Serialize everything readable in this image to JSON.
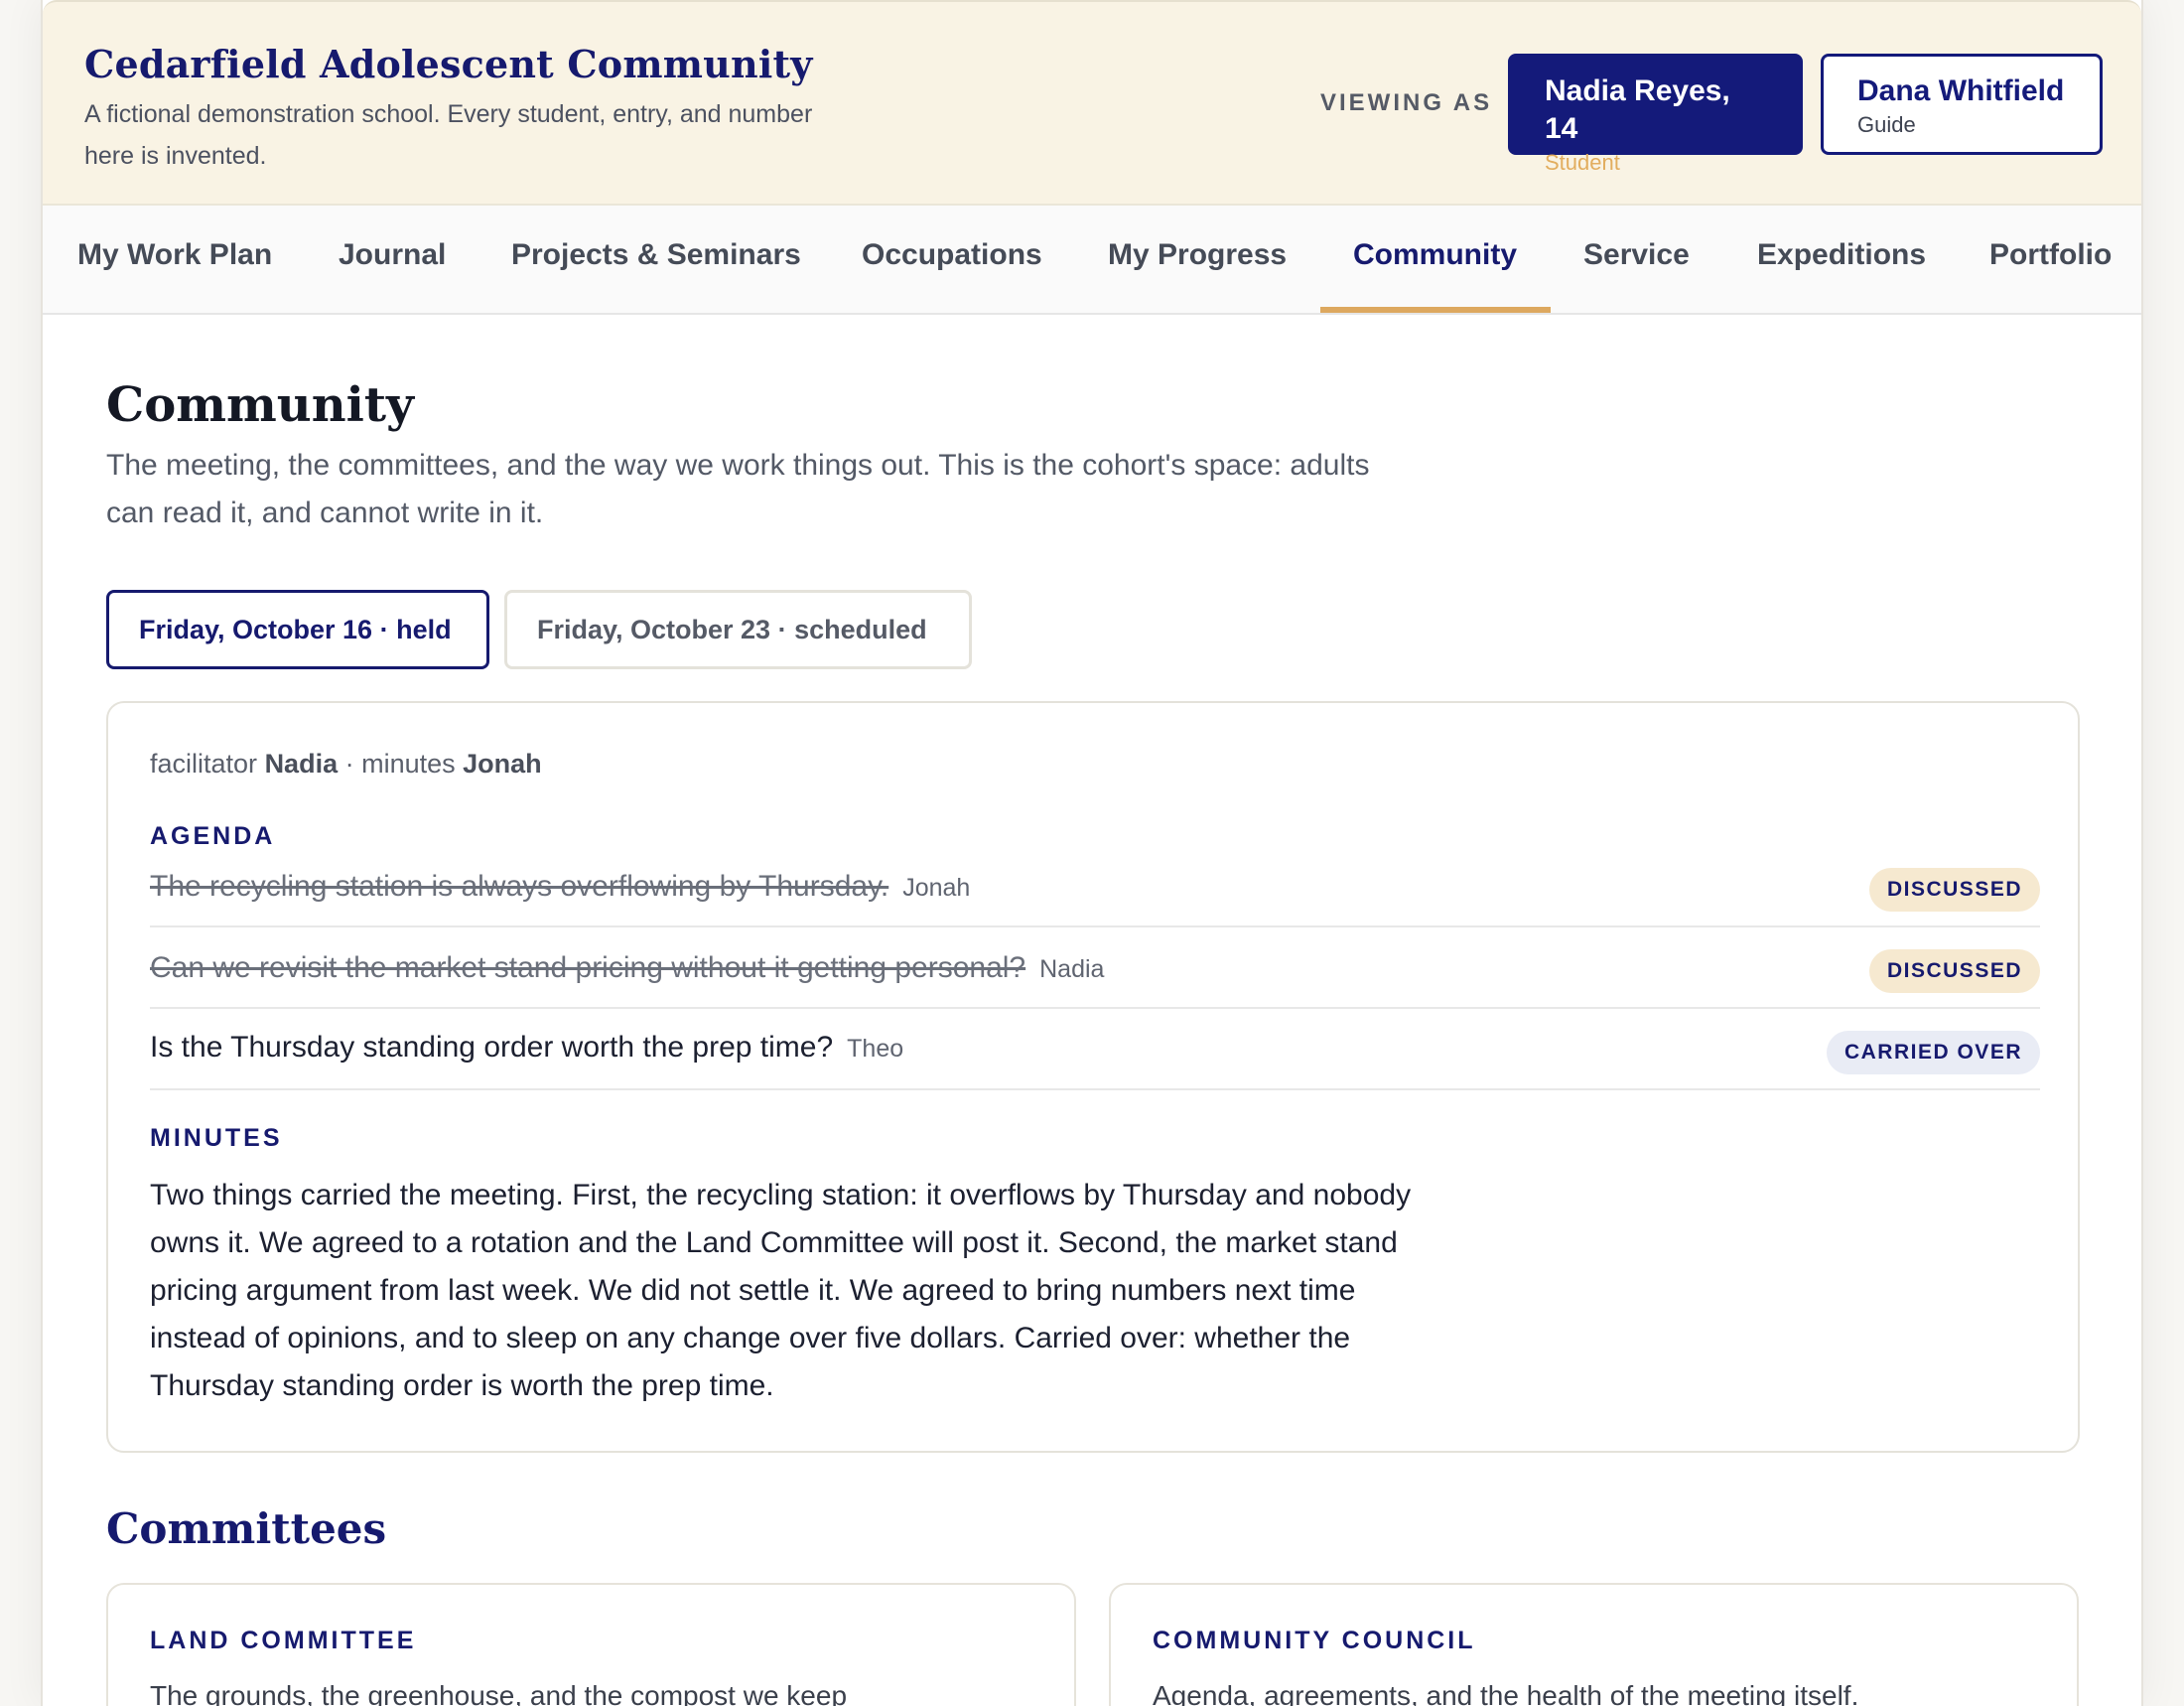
{
  "header": {
    "title": "Cedarfield Adolescent Community",
    "subtitle": "A fictional demonstration school. Every student, entry, and number here is invented.",
    "viewing_as_label": "VIEWING AS",
    "roles": [
      {
        "name": "Nadia Reyes, 14",
        "role": "Student",
        "selected": true
      },
      {
        "name": "Dana Whitfield",
        "role": "Guide",
        "selected": false
      }
    ]
  },
  "nav": {
    "items": [
      {
        "label": "My Work Plan"
      },
      {
        "label": "Journal"
      },
      {
        "label": "Projects & Seminars"
      },
      {
        "label": "Occupations"
      },
      {
        "label": "My Progress"
      },
      {
        "label": "Community"
      },
      {
        "label": "Service"
      },
      {
        "label": "Expeditions"
      },
      {
        "label": "Portfolio"
      }
    ],
    "active": "Community"
  },
  "page": {
    "title": "Community",
    "description": "The meeting, the committees, and the way we work things out. This is the cohort's space: adults can read it, and cannot write in it."
  },
  "meetings": {
    "tabs": [
      {
        "label": "Friday, October 16 · held",
        "selected": true
      },
      {
        "label": "Friday, October 23 · scheduled",
        "selected": false
      }
    ],
    "current": {
      "facilitator_label": "facilitator",
      "facilitator": "Nadia",
      "separator": " · ",
      "minutes_label": "minutes",
      "minutes_taker": "Jonah",
      "agenda_label": "AGENDA",
      "agenda": [
        {
          "text": "The recycling station is always overflowing by Thursday.",
          "who": "Jonah",
          "status": "DISCUSSED",
          "done": true
        },
        {
          "text": "Can we revisit the market stand pricing without it getting personal?",
          "who": "Nadia",
          "status": "DISCUSSED",
          "done": true
        },
        {
          "text": "Is the Thursday standing order worth the prep time?",
          "who": "Theo",
          "status": "CARRIED OVER",
          "done": false
        }
      ],
      "minutes_heading": "MINUTES",
      "minutes": "Two things carried the meeting. First, the recycling station: it overflows by Thursday and nobody owns it. We agreed to a rotation and the Land Committee will post it. Second, the market stand pricing argument from last week. We did not settle it. We agreed to bring numbers next time instead of opinions, and to sleep on any change over five dollars. Carried over: whether the Thursday standing order is worth the prep time."
    }
  },
  "committees": {
    "title": "Committees",
    "items": [
      {
        "name": "LAND COMMITTEE",
        "description": "The grounds, the greenhouse, and the compost we keep"
      },
      {
        "name": "COMMUNITY COUNCIL",
        "description": "Agenda, agreements, and the health of the meeting itself."
      }
    ]
  },
  "colors": {
    "accent": "#161a6e",
    "header_bg": "#f9f3e4",
    "tab_underline": "#dda85f",
    "discussed_badge": "#f6e9d0",
    "carried_badge": "#e9ecf5"
  }
}
